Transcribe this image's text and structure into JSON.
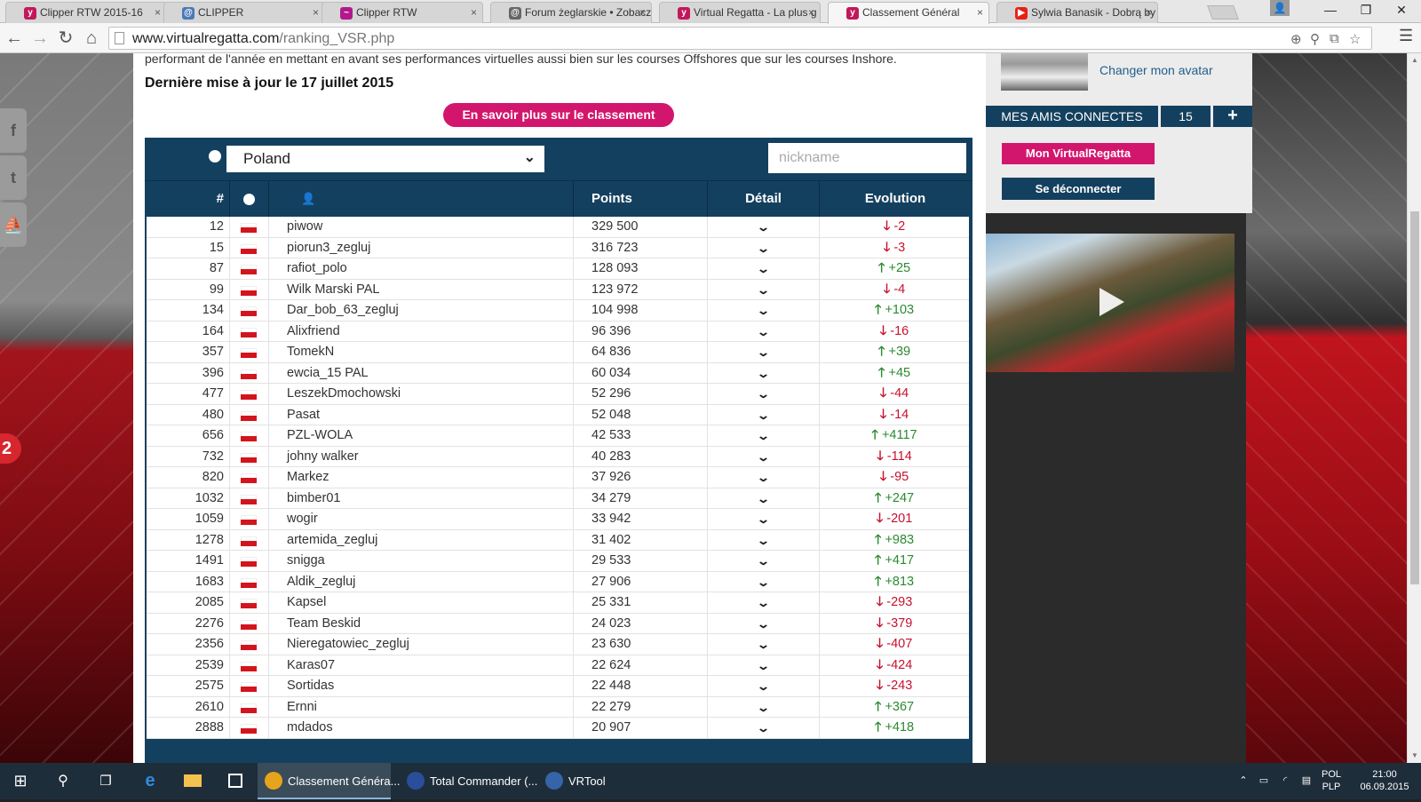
{
  "browser": {
    "tabs": [
      {
        "label": "Clipper RTW 2015-16",
        "color": "#c2185b",
        "glyph": "y"
      },
      {
        "label": "CLIPPER",
        "color": "#4a79b8",
        "glyph": "@"
      },
      {
        "label": "Clipper RTW",
        "color": "#b2188b",
        "glyph": "~"
      },
      {
        "label": "Forum żeglarskie • Zobacz",
        "color": "#666666",
        "glyph": "@"
      },
      {
        "label": "Virtual Regatta - La plus g",
        "color": "#c2185b",
        "glyph": "y"
      },
      {
        "label": "Classement Général",
        "color": "#c2185b",
        "glyph": "y"
      },
      {
        "label": "Sylwia Banasik - Dobrą by",
        "color": "#e62117",
        "glyph": "▶"
      }
    ],
    "tab_close_glyph": "×",
    "window_controls": {
      "minimize": "—",
      "restore": "❐",
      "close": "✕",
      "user": "👤"
    },
    "nav": {
      "back": "←",
      "forward": "→",
      "reload": "↻",
      "home": "⌂"
    },
    "url_domain": "www.virtualregatta.com",
    "url_path": "/ranking_VSR.php",
    "omnibox_icons": {
      "zoom": "⊕",
      "pin": "⚲",
      "translate": "⧉",
      "star": "☆"
    },
    "menu_icon": "☰"
  },
  "page": {
    "intro_text": "performant de l'année en mettant en avant ses performances virtuelles aussi bien sur les courses Offshores que sur les courses Inshore.",
    "updated_text": "Dernière mise à jour le 17 juillet 2015",
    "learn_more_label": "En savoir plus sur le classement",
    "social": {
      "facebook": "f",
      "twitter": "t",
      "boat": "⛵"
    },
    "badge_number": "2"
  },
  "ranking": {
    "country_selected": "Poland",
    "nickname_placeholder": "nickname",
    "headers": {
      "rank": "#",
      "points": "Points",
      "detail": "Détail",
      "evolution": "Evolution"
    },
    "user_icon": "👤",
    "detail_glyph": "⌄",
    "arrow_up": "🡑",
    "arrow_down": "🡓",
    "rows": [
      {
        "rank": "12",
        "name": "piwow",
        "points": "329 500",
        "dir": "down",
        "evo": "-2"
      },
      {
        "rank": "15",
        "name": "piorun3_zegluj",
        "points": "316 723",
        "dir": "down",
        "evo": "-3"
      },
      {
        "rank": "87",
        "name": "rafiot_polo",
        "points": "128 093",
        "dir": "up",
        "evo": "+25"
      },
      {
        "rank": "99",
        "name": "Wilk Marski PAL",
        "points": "123 972",
        "dir": "down",
        "evo": "-4"
      },
      {
        "rank": "134",
        "name": "Dar_bob_63_zegluj",
        "points": "104 998",
        "dir": "up",
        "evo": "+103"
      },
      {
        "rank": "164",
        "name": "Alixfriend",
        "points": "96 396",
        "dir": "down",
        "evo": "-16"
      },
      {
        "rank": "357",
        "name": "TomekN",
        "points": "64 836",
        "dir": "up",
        "evo": "+39"
      },
      {
        "rank": "396",
        "name": "ewcia_15 PAL",
        "points": "60 034",
        "dir": "up",
        "evo": "+45"
      },
      {
        "rank": "477",
        "name": "LeszekDmochowski",
        "points": "52 296",
        "dir": "down",
        "evo": "-44"
      },
      {
        "rank": "480",
        "name": "Pasat",
        "points": "52 048",
        "dir": "down",
        "evo": "-14"
      },
      {
        "rank": "656",
        "name": "PZL-WOLA",
        "points": "42 533",
        "dir": "up",
        "evo": "+4117"
      },
      {
        "rank": "732",
        "name": "johny walker",
        "points": "40 283",
        "dir": "down",
        "evo": "-114"
      },
      {
        "rank": "820",
        "name": "Markez",
        "points": "37 926",
        "dir": "down",
        "evo": "-95"
      },
      {
        "rank": "1032",
        "name": "bimber01",
        "points": "34 279",
        "dir": "up",
        "evo": "+247"
      },
      {
        "rank": "1059",
        "name": "wogir",
        "points": "33 942",
        "dir": "down",
        "evo": "-201"
      },
      {
        "rank": "1278",
        "name": "artemida_zegluj",
        "points": "31 402",
        "dir": "up",
        "evo": "+983"
      },
      {
        "rank": "1491",
        "name": "snigga",
        "points": "29 533",
        "dir": "up",
        "evo": "+417"
      },
      {
        "rank": "1683",
        "name": "Aldik_zegluj",
        "points": "27 906",
        "dir": "up",
        "evo": "+813"
      },
      {
        "rank": "2085",
        "name": "Kapsel",
        "points": "25 331",
        "dir": "down",
        "evo": "-293"
      },
      {
        "rank": "2276",
        "name": "Team Beskid",
        "points": "24 023",
        "dir": "down",
        "evo": "-379"
      },
      {
        "rank": "2356",
        "name": "Nieregatowiec_zegluj",
        "points": "23 630",
        "dir": "down",
        "evo": "-407"
      },
      {
        "rank": "2539",
        "name": "Karas07",
        "points": "22 624",
        "dir": "down",
        "evo": "-424"
      },
      {
        "rank": "2575",
        "name": "Sortidas",
        "points": "22 448",
        "dir": "down",
        "evo": "-243"
      },
      {
        "rank": "2610",
        "name": "Ernni",
        "points": "22 279",
        "dir": "up",
        "evo": "+367"
      },
      {
        "rank": "2888",
        "name": "mdados",
        "points": "20 907",
        "dir": "up",
        "evo": "+418"
      }
    ]
  },
  "sidebar": {
    "change_avatar": "Changer mon avatar",
    "friends_label": "MES AMIS CONNECTES",
    "friends_count": "15",
    "friends_add": "+",
    "my_vr": "Mon VirtualRegatta",
    "logout": "Se déconnecter"
  },
  "taskbar": {
    "start_icon": "⊞",
    "search_icon": "⚲",
    "taskview_icon": "❐",
    "apps": [
      {
        "label": "Classement Généra...",
        "color": "#e6a31c"
      },
      {
        "label": "Total Commander (...",
        "color": "#2a4e9b"
      },
      {
        "label": "VRTool",
        "color": "#3564a8"
      }
    ],
    "lang": "POL",
    "layout": "PLP",
    "time": "21:00",
    "date": "06.09.2015"
  }
}
